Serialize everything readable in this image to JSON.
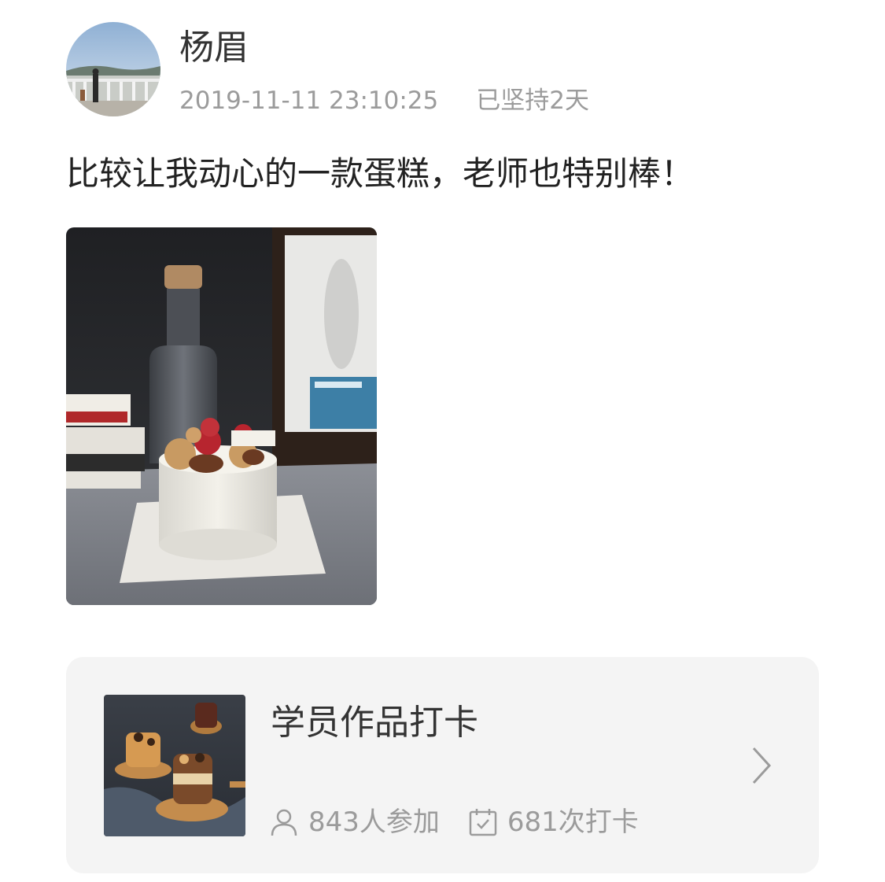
{
  "post": {
    "author": "杨眉",
    "timestamp": "2019-11-11 23:10:25",
    "streak": "已坚持2天",
    "text": "比较让我动心的一款蛋糕，老师也特别棒！"
  },
  "course_card": {
    "title": "学员作品打卡",
    "participants": "843人参加",
    "checkins": "681次打卡",
    "participants_icon": "person-icon",
    "checkins_icon": "calendar-check-icon",
    "arrow_icon": "chevron-right-icon"
  },
  "colors": {
    "text_primary": "#222222",
    "text_secondary": "#9b9b9b",
    "card_background": "#f4f4f4"
  }
}
